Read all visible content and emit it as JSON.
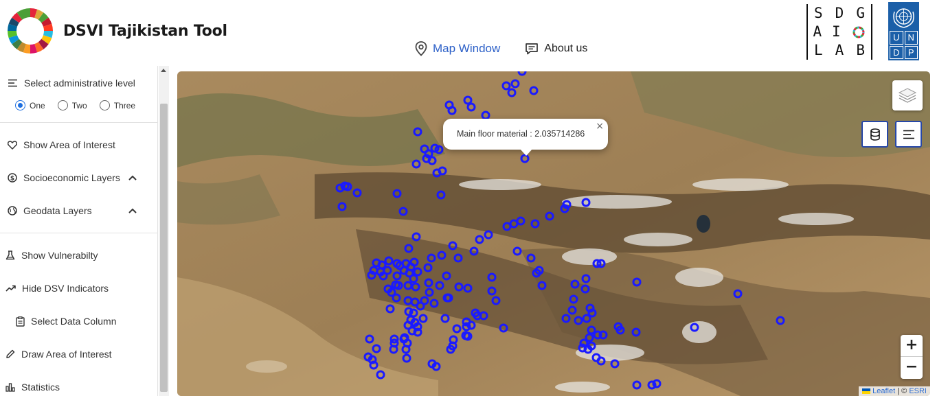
{
  "header": {
    "title": "DSVI Tajikistan Tool",
    "nav": {
      "map_window": "Map Window",
      "about_us": "About us"
    },
    "sdg_lab": {
      "row1": [
        "S",
        "D",
        "G"
      ],
      "row2": [
        "A",
        "I",
        "○"
      ],
      "row3": [
        "L",
        "A",
        "B"
      ]
    },
    "undp": [
      "U",
      "N",
      "D",
      "P"
    ]
  },
  "sidebar": {
    "admin_level_label": "Select administrative level",
    "levels": [
      "One",
      "Two",
      "Three"
    ],
    "selected_level": "One",
    "items": {
      "show_area": "Show Area of Interest",
      "socioeconomic": "Socioeconomic Layers",
      "geodata": "Geodata Layers",
      "show_vulnerability": "Show Vulnerabilty",
      "hide_dsv": "Hide DSV Indicators",
      "select_column": "Select Data Column",
      "draw_area": "Draw Area of Interest",
      "statistics": "Statistics"
    }
  },
  "map": {
    "popup_text": "Main floor material : 2.035714286",
    "popup_close": "×",
    "zoom_in": "+",
    "zoom_out": "−",
    "attribution_leaflet": "Leaflet",
    "attribution_sep": " | © ",
    "attribution_esri": "ESRI",
    "marker_color": "#1a1aff"
  }
}
